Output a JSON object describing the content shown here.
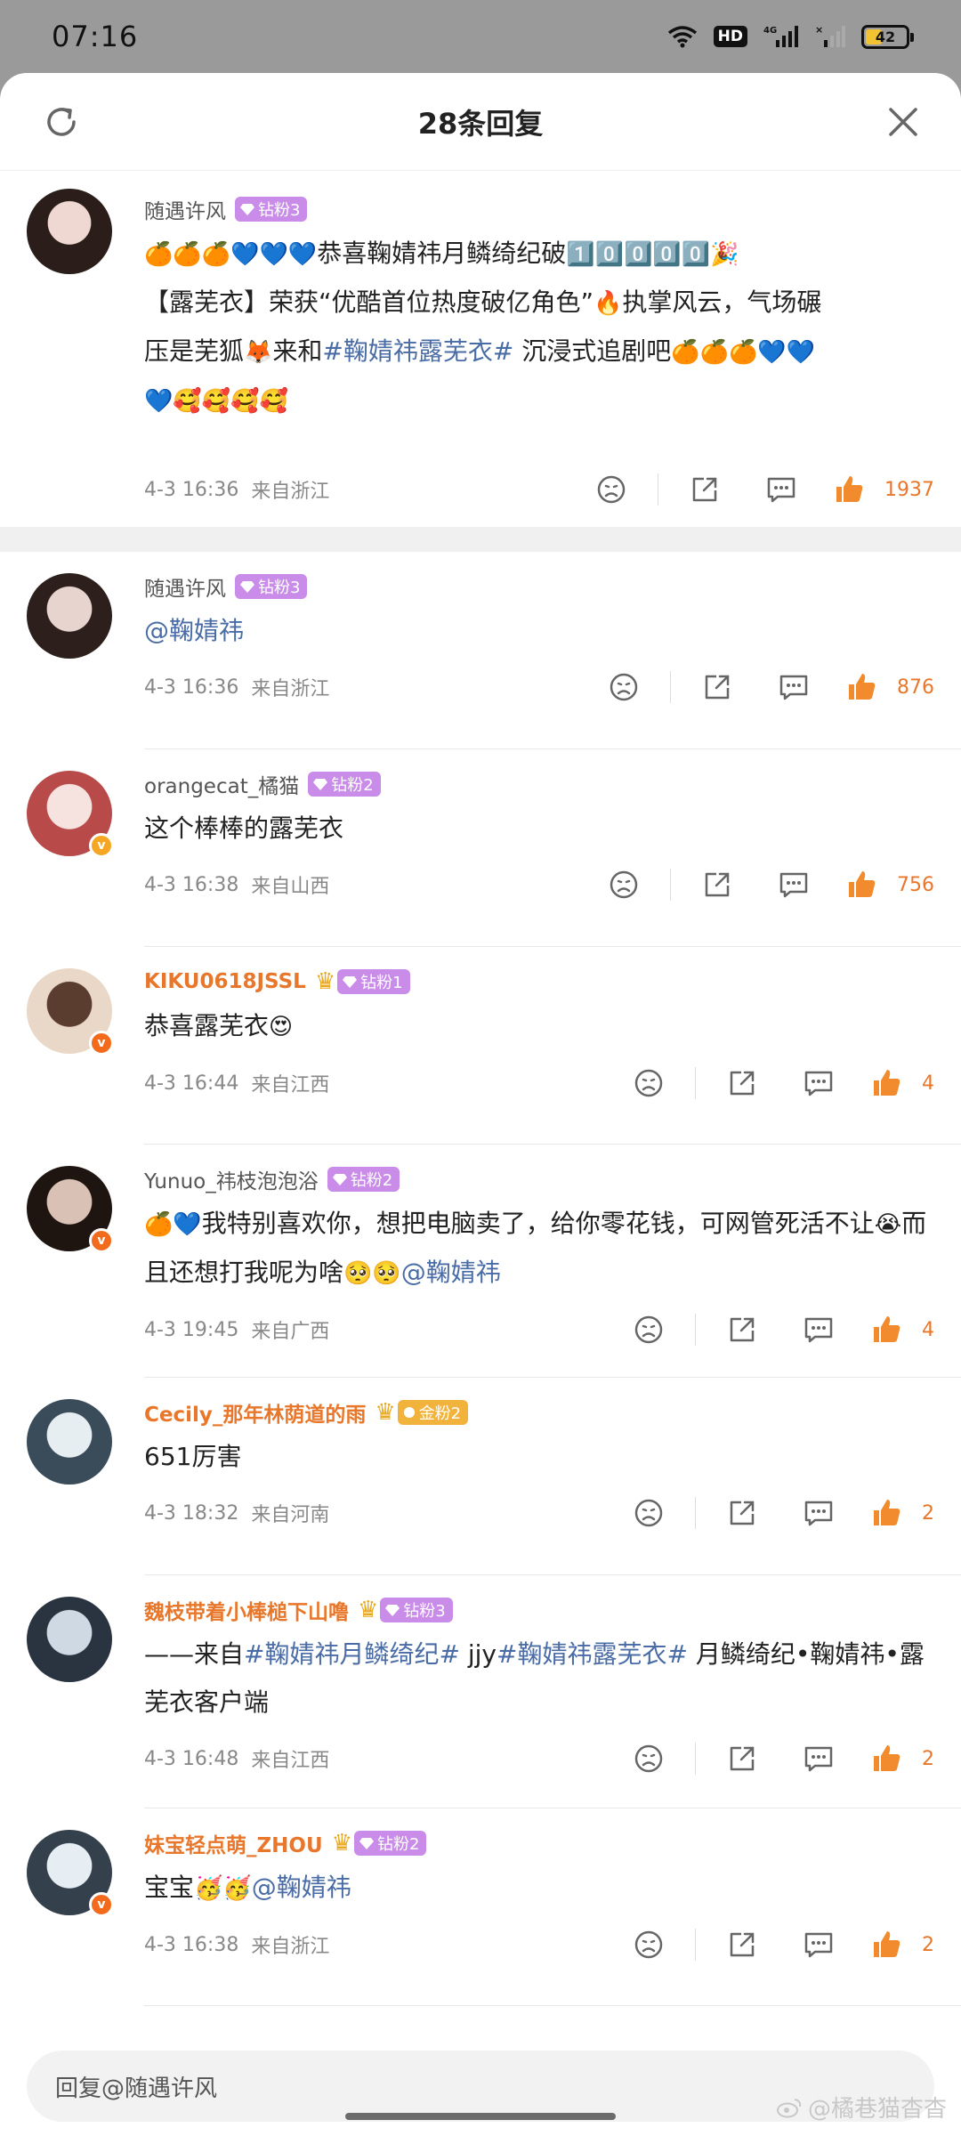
{
  "status": {
    "time": "07:16",
    "battery": "42",
    "hd": "HD"
  },
  "header": {
    "title": "28条回复"
  },
  "colors": {
    "accent_orange": "#e8772b",
    "tag_blue": "#4a6ca6",
    "fan_purple": "#c98ce8",
    "fan_gold": "#f1b33c"
  },
  "main_comment": {
    "username": "随遇许风",
    "fan_badge": "钻粉3",
    "line1_prefix": "🍊🍊🍊💙💙💙",
    "line1_text": "恭喜鞠婧祎月鳞绮纪破",
    "line1_num": "1️⃣0️⃣0️⃣0️⃣0️⃣",
    "line1_emoji": "🎉",
    "line2_text": "【露芜衣】荣获“优酷首位热度破亿角色”",
    "line2_emoji": "🔥",
    "line2_after": "执掌风云，气场碾",
    "line3_text": "压是芜狐",
    "line3_emoji": "🦊",
    "line3_after": "来和",
    "line3_tag": "#鞠婧祎露芜衣#",
    "line3_tail": " 沉浸式追剧吧",
    "line3_emojis": "🍊🍊🍊💙💙",
    "line4_emojis": "💙🥰🥰🥰🥰",
    "date": "4-3 16:36",
    "location": "来自浙江",
    "likes": "1937"
  },
  "replies": [
    {
      "username": "随遇许风",
      "name_style": "gray",
      "crown": false,
      "fan_badge": "钻粉3",
      "fan_style": "purple",
      "avatar_colors": [
        "#e7d4cf",
        "#2c1f1c"
      ],
      "vbadge": "",
      "text_parts": [
        {
          "type": "tag",
          "v": "@鞠婧祎"
        }
      ],
      "date": "4-3 16:36",
      "location": "来自浙江",
      "likes": "876"
    },
    {
      "username": "orangecat_橘猫",
      "name_style": "gray",
      "crown": false,
      "fan_badge": "钻粉2",
      "fan_style": "purple",
      "avatar_colors": [
        "#f6e2de",
        "#b84a4a"
      ],
      "vbadge": "gold",
      "text_parts": [
        {
          "type": "text",
          "v": "这个棒棒的露芜衣"
        }
      ],
      "date": "4-3 16:38",
      "location": "来自山西",
      "likes": "756"
    },
    {
      "username": "KIKU0618JSSL",
      "name_style": "orange",
      "crown": true,
      "fan_badge": "钻粉1",
      "fan_style": "purple",
      "avatar_colors": [
        "#5a3d2e",
        "#e9d7c7"
      ],
      "vbadge": "orange",
      "text_parts": [
        {
          "type": "text",
          "v": "恭喜露芜衣"
        },
        {
          "type": "emo",
          "v": "😍"
        }
      ],
      "date": "4-3 16:44",
      "location": "来自江西",
      "likes": "4"
    },
    {
      "username": "Yunuo_祎枝泡泡浴",
      "name_style": "gray",
      "crown": false,
      "fan_badge": "钻粉2",
      "fan_style": "purple",
      "avatar_colors": [
        "#d9c2b5",
        "#1e1410"
      ],
      "vbadge": "orange",
      "text_parts": [
        {
          "type": "emo",
          "v": "🍊💙"
        },
        {
          "type": "text",
          "v": "我特别喜欢你，想把电脑卖了，给你零花钱，可网管死活不让"
        },
        {
          "type": "emo",
          "v": "😭"
        },
        {
          "type": "text",
          "v": "而且还想打我呢为啥"
        },
        {
          "type": "emo",
          "v": "🥺🥺"
        },
        {
          "type": "tag",
          "v": "@鞠婧祎"
        }
      ],
      "date": "4-3 19:45",
      "location": "来自广西",
      "likes": "4"
    },
    {
      "username": "Cecily_那年林荫道的雨",
      "name_style": "orange",
      "crown": true,
      "fan_badge": "金粉2",
      "fan_style": "gold",
      "avatar_colors": [
        "#e7eef2",
        "#3a4b5a"
      ],
      "vbadge": "",
      "text_parts": [
        {
          "type": "text",
          "v": "651厉害"
        }
      ],
      "date": "4-3 18:32",
      "location": "来自河南",
      "likes": "2"
    },
    {
      "username": "魏枝带着小棒槌下山噜",
      "name_style": "orange",
      "crown": true,
      "fan_badge": "钻粉3",
      "fan_style": "purple",
      "avatar_colors": [
        "#cfd9e3",
        "#2a3340"
      ],
      "vbadge": "",
      "text_parts": [
        {
          "type": "text",
          "v": "——来自"
        },
        {
          "type": "tag",
          "v": "#鞠婧祎月鳞绮纪#"
        },
        {
          "type": "text",
          "v": " jjy"
        },
        {
          "type": "tag",
          "v": "#鞠婧祎露芜衣#"
        },
        {
          "type": "text",
          "v": " 月鳞绮纪•鞠婧祎•露芜衣客户端"
        }
      ],
      "date": "4-3 16:48",
      "location": "来自江西",
      "likes": "2"
    },
    {
      "username": "妹宝轻点萌_ZHOU",
      "name_style": "orange",
      "crown": true,
      "fan_badge": "钻粉2",
      "fan_style": "purple",
      "avatar_colors": [
        "#e6eef4",
        "#34404c"
      ],
      "vbadge": "orange",
      "text_parts": [
        {
          "type": "text",
          "v": "宝宝"
        },
        {
          "type": "emo",
          "v": "🥳🥳"
        },
        {
          "type": "tag",
          "v": "@鞠婧祎"
        }
      ],
      "date": "4-3 16:38",
      "location": "来自浙江",
      "likes": "2"
    }
  ],
  "reply_bar": {
    "placeholder": "回复@随遇许风"
  },
  "watermark": {
    "text": "@橘巷猫杳杳"
  }
}
